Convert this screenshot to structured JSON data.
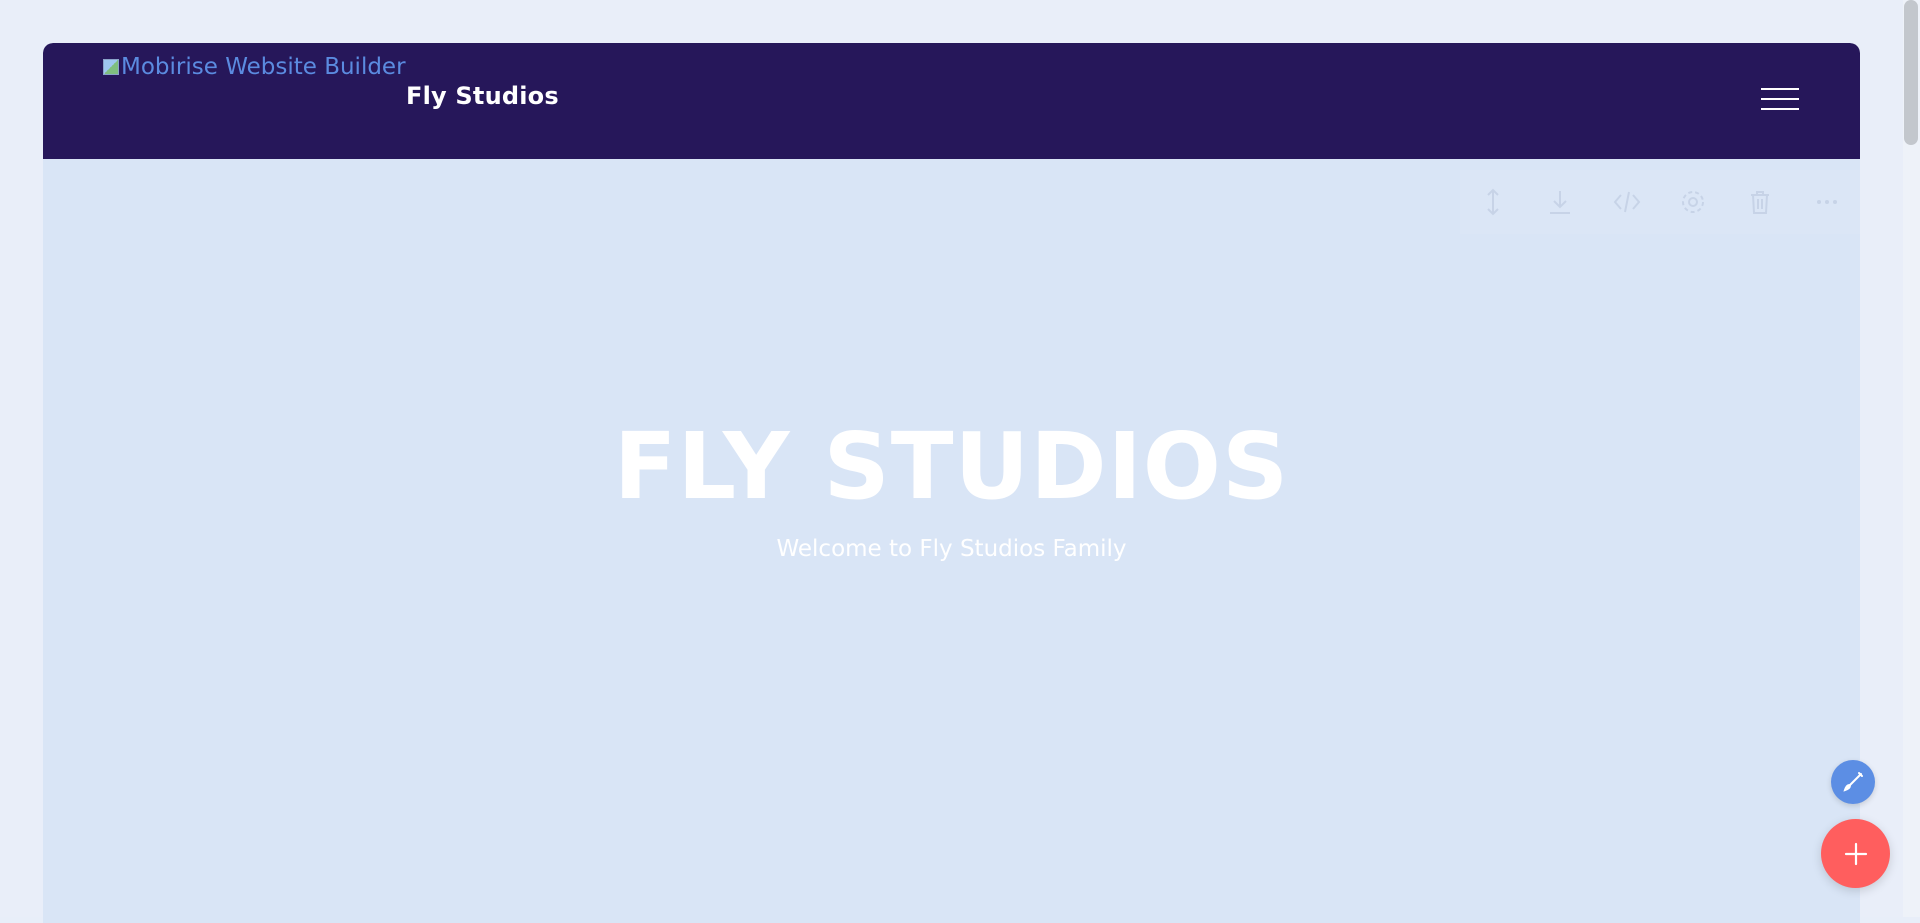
{
  "navbar": {
    "logo_alt": "Mobirise Website Builder",
    "brand_name": "Fly Studios",
    "menu_icon": "hamburger-menu-icon"
  },
  "block_toolbar": {
    "buttons": [
      {
        "icon": "move-updown-icon"
      },
      {
        "icon": "download-icon"
      },
      {
        "icon": "code-icon"
      },
      {
        "icon": "gear-icon"
      },
      {
        "icon": "trash-icon"
      },
      {
        "icon": "more-icon"
      }
    ]
  },
  "hero": {
    "title": "FLY STUDIOS",
    "subtitle": "Welcome to Fly Studios Family"
  },
  "floating": {
    "edit_icon": "brush-icon",
    "add_icon": "plus-icon"
  },
  "colors": {
    "navbar_bg": "#26175a",
    "hero_bg": "#d9e5f6",
    "edit_fab": "#5c8ee4",
    "add_fab": "#ff5e5e",
    "logo_link": "#5b8be0"
  }
}
